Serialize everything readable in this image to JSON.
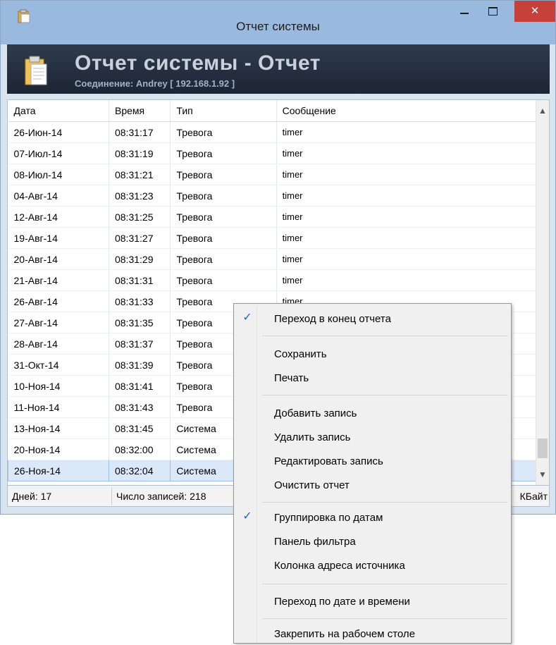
{
  "window": {
    "title": "Отчет системы",
    "close_glyph": "✕"
  },
  "header": {
    "title": "Отчет системы - Отчет",
    "subtitle": "Соединение: Andrey [ 192.168.1.92 ]"
  },
  "grid": {
    "columns": [
      "Дата",
      "Время",
      "Тип",
      "Сообщение"
    ],
    "rows": [
      {
        "date": "26-Июн-14",
        "time": "08:31:17",
        "type": "Тревога",
        "msg": "timer"
      },
      {
        "date": "07-Июл-14",
        "time": "08:31:19",
        "type": "Тревога",
        "msg": "timer"
      },
      {
        "date": "08-Июл-14",
        "time": "08:31:21",
        "type": "Тревога",
        "msg": "timer"
      },
      {
        "date": "04-Авг-14",
        "time": "08:31:23",
        "type": "Тревога",
        "msg": "timer"
      },
      {
        "date": "12-Авг-14",
        "time": "08:31:25",
        "type": "Тревога",
        "msg": "timer"
      },
      {
        "date": "19-Авг-14",
        "time": "08:31:27",
        "type": "Тревога",
        "msg": "timer"
      },
      {
        "date": "20-Авг-14",
        "time": "08:31:29",
        "type": "Тревога",
        "msg": "timer"
      },
      {
        "date": "21-Авг-14",
        "time": "08:31:31",
        "type": "Тревога",
        "msg": "timer"
      },
      {
        "date": "26-Авг-14",
        "time": "08:31:33",
        "type": "Тревога",
        "msg": "timer"
      },
      {
        "date": "27-Авг-14",
        "time": "08:31:35",
        "type": "Тревога",
        "msg": ""
      },
      {
        "date": "28-Авг-14",
        "time": "08:31:37",
        "type": "Тревога",
        "msg": ""
      },
      {
        "date": "31-Окт-14",
        "time": "08:31:39",
        "type": "Тревога",
        "msg": ""
      },
      {
        "date": "10-Ноя-14",
        "time": "08:31:41",
        "type": "Тревога",
        "msg": ""
      },
      {
        "date": "11-Ноя-14",
        "time": "08:31:43",
        "type": "Тревога",
        "msg": ""
      },
      {
        "date": "13-Ноя-14",
        "time": "08:31:45",
        "type": "Система",
        "msg": ""
      },
      {
        "date": "20-Ноя-14",
        "time": "08:32:00",
        "type": "Система",
        "msg": ""
      },
      {
        "date": "26-Ноя-14",
        "time": "08:32:04",
        "type": "Система",
        "msg": ""
      }
    ],
    "selected_row": "26-Ноя-14"
  },
  "status": {
    "days": "Дней: 17",
    "records": "Число записей: 218",
    "size_fragment": "КБайт"
  },
  "context_menu": {
    "items": [
      {
        "label": "Переход в конец отчета",
        "checked": true
      },
      {
        "label": "Сохранить",
        "checked": false
      },
      {
        "label": "Печать",
        "checked": false
      },
      {
        "label": "Добавить запись",
        "checked": false
      },
      {
        "label": "Удалить запись",
        "checked": false
      },
      {
        "label": "Редактировать запись",
        "checked": false
      },
      {
        "label": "Очистить отчет",
        "checked": false
      },
      {
        "label": "Группировка по датам",
        "checked": true
      },
      {
        "label": "Панель фильтра",
        "checked": false
      },
      {
        "label": "Колонка адреса источника",
        "checked": false
      },
      {
        "label": "Переход по дате и времени",
        "checked": false
      },
      {
        "label": "Закрепить на рабочем столе",
        "checked": false
      }
    ],
    "check_glyph": "✓"
  },
  "colors": {
    "titlebar": "#9ab9de",
    "header_panel": "#2f3b4d",
    "close_button": "#c7403a",
    "selection": "#dbe8f9",
    "check_mark": "#1a66c2"
  }
}
